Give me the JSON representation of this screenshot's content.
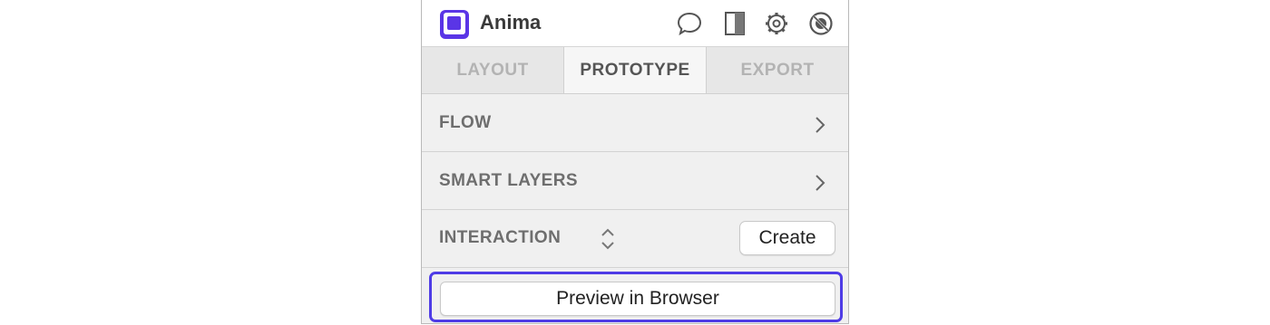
{
  "app": {
    "title": "Anima",
    "logo_icon": "anima-logo",
    "brand_color": "#5a35e6"
  },
  "toolbar": {
    "icons": [
      "comment-icon",
      "split-view-icon",
      "gear-icon",
      "disable-icon"
    ]
  },
  "tabs": [
    {
      "label": "LAYOUT",
      "active": false
    },
    {
      "label": "PROTOTYPE",
      "active": true
    },
    {
      "label": "EXPORT",
      "active": false
    }
  ],
  "sections": {
    "flow": {
      "label": "FLOW"
    },
    "smart_layers": {
      "label": "SMART LAYERS"
    },
    "interaction": {
      "label": "INTERACTION",
      "create_label": "Create"
    }
  },
  "preview": {
    "label": "Preview in Browser",
    "highlight_color": "#4f3ce6"
  }
}
